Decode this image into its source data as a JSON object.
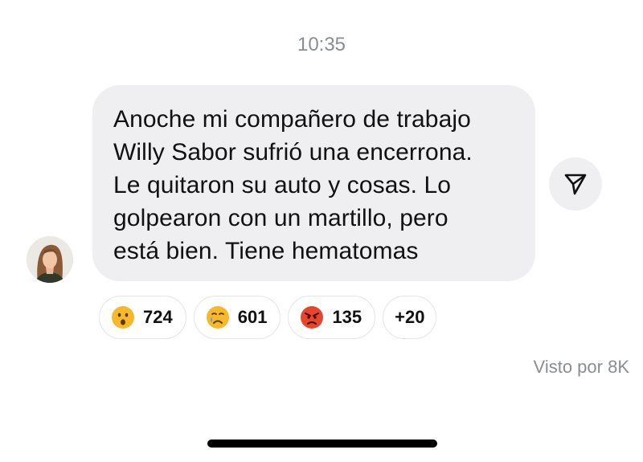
{
  "message": {
    "time": "10:35",
    "text": "Anoche mi compañero de trabajo\nWilly Sabor sufrió una encerrona.\nLe quitaron su auto y cosas. Lo\ngolpearon con un martillo, pero\nestá bien. Tiene hematomas",
    "seen_label": "Visto por 8K"
  },
  "sender": {
    "avatar_icon": "profile-photo"
  },
  "actions": {
    "share_icon": "send-icon"
  },
  "reactions": [
    {
      "icon": "surprised-face-emoji",
      "count": "724"
    },
    {
      "icon": "crying-face-emoji",
      "count": "601"
    },
    {
      "icon": "angry-face-emoji",
      "count": "135"
    }
  ],
  "reactions_more": "+20",
  "colors": {
    "bubble_bg": "#efeff1",
    "muted_text": "#8a8d91",
    "emoji_yellow": "#f7b82a",
    "emoji_red": "#e8452c"
  }
}
